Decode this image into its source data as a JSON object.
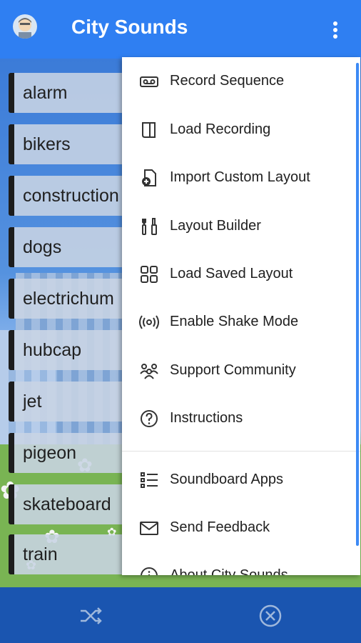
{
  "app": {
    "title": "City Sounds"
  },
  "sounds": [
    "alarm",
    "bikers",
    "construction",
    "dogs",
    "electrichum",
    "hubcap",
    "jet",
    "pigeon",
    "skateboard",
    "train"
  ],
  "menu": {
    "items": [
      {
        "label": "Record Sequence",
        "icon": "tape-icon"
      },
      {
        "label": "Load Recording",
        "icon": "load-file-icon"
      },
      {
        "label": "Import Custom Layout",
        "icon": "import-icon"
      },
      {
        "label": "Layout Builder",
        "icon": "layout-builder-icon"
      },
      {
        "label": "Load Saved Layout",
        "icon": "grid-icon"
      },
      {
        "label": "Enable Shake Mode",
        "icon": "vibration-icon"
      },
      {
        "label": "Support Community",
        "icon": "community-icon"
      },
      {
        "label": "Instructions",
        "icon": "help-icon"
      },
      {
        "label": "Soundboard Apps",
        "icon": "list-icon"
      },
      {
        "label": "Send Feedback",
        "icon": "mail-icon"
      },
      {
        "label": "About City Sounds",
        "icon": "info-icon"
      }
    ]
  },
  "colors": {
    "appbar": "#2f7ff2",
    "bottombar": "#1a55b0",
    "accent": "#3d8af5"
  }
}
